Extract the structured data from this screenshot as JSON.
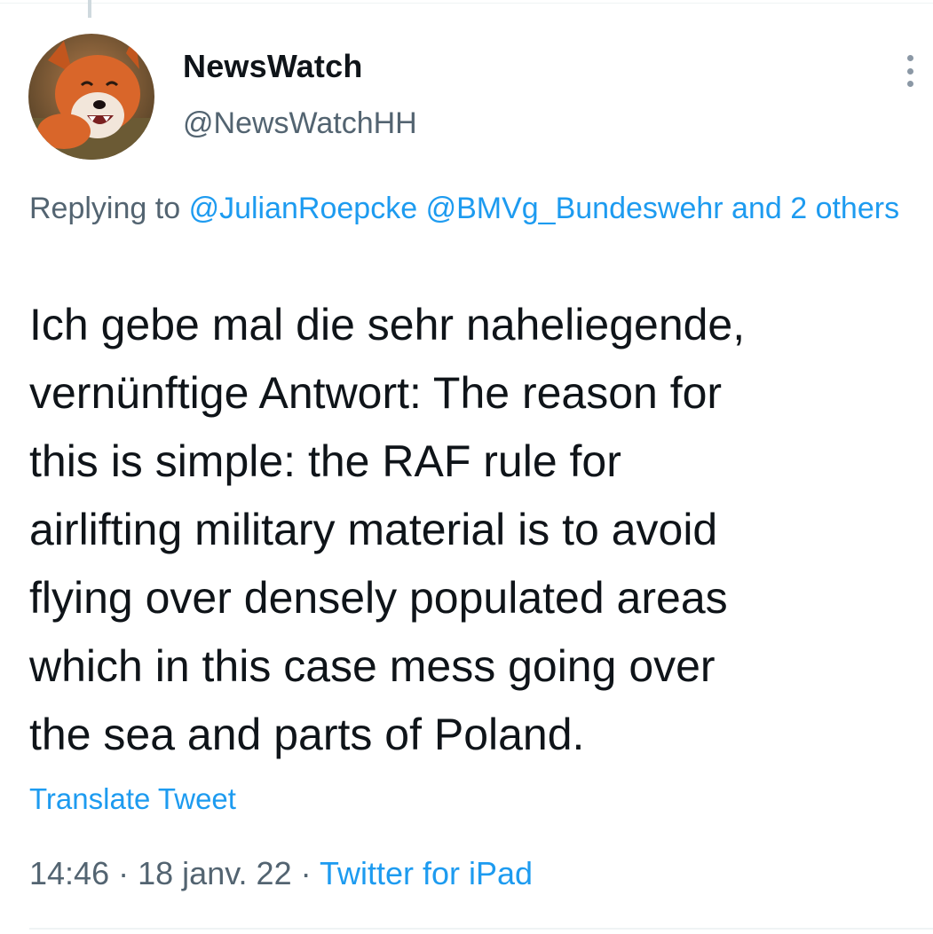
{
  "tweet": {
    "author": {
      "display_name": "NewsWatch",
      "handle": "@NewsWatchHH",
      "avatar_icon": "fox-avatar"
    },
    "replying": {
      "prefix": "Replying to",
      "mentions": [
        "@JulianRoepcke",
        "@BMVg_Bundeswehr"
      ],
      "suffix": "and 2 others"
    },
    "text": "Ich gebe mal die sehr naheliegende,\nvernünftige Antwort: The reason for\nthis is simple: the RAF rule for\nairlifting military material is to avoid\nflying over densely populated areas\nwhich in this case mess going over\nthe sea and parts of Poland.",
    "translate_label": "Translate Tweet",
    "time": "14:46",
    "separator": "·",
    "date": "18 janv. 22",
    "source": "Twitter for iPad",
    "more_icon": "more-options-icon"
  },
  "colors": {
    "link": "#1d9bf0",
    "secondary_text": "#536471",
    "primary_text": "#0f1419"
  }
}
